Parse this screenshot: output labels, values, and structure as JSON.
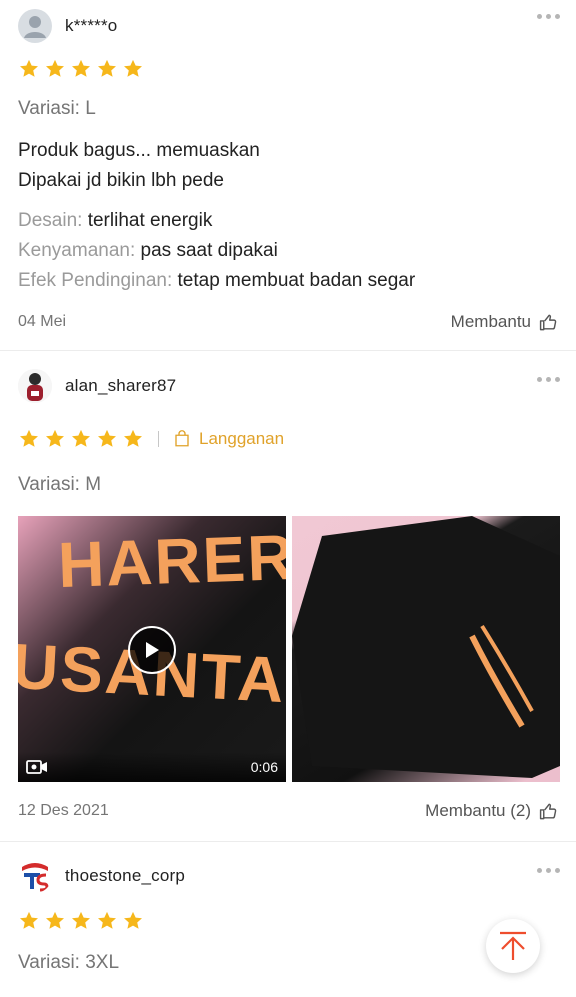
{
  "reviews": [
    {
      "username": "k*****o",
      "rating": 5,
      "variation": "Variasi: L",
      "body_lines": [
        "Produk bagus... memuaskan",
        "Dipakai jd bikin lbh pede"
      ],
      "attributes": [
        {
          "key": "Desain:",
          "value": "terlihat energik"
        },
        {
          "key": "Kenyamanan:",
          "value": "pas saat dipakai"
        },
        {
          "key": "Efek Pendinginan:",
          "value": "tetap membuat badan segar"
        }
      ],
      "date": "04 Mei",
      "helpful_label": "Membantu"
    },
    {
      "username": "alan_sharer87",
      "rating": 5,
      "badge": "Langganan",
      "variation": "Variasi: M",
      "video_duration": "0:06",
      "date": "12 Des 2021",
      "helpful_label": "Membantu (2)"
    },
    {
      "username": "thoestone_corp",
      "rating": 5,
      "variation": "Variasi: 3XL"
    }
  ],
  "colors": {
    "star": "#f6b71b",
    "badge": "#e0a22a",
    "fab_arrow": "#ee4d2d"
  }
}
